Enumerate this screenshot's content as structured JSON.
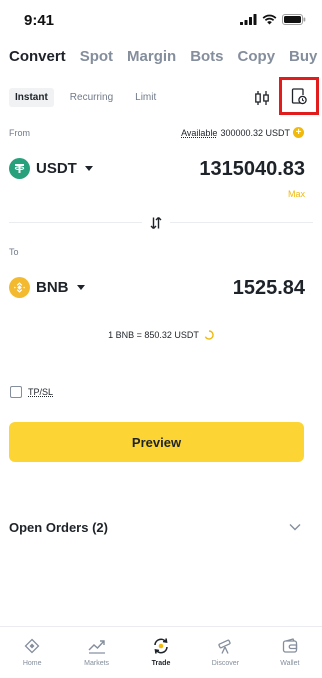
{
  "status_bar": {
    "time": "9:41"
  },
  "top_tabs": [
    {
      "label": "Convert",
      "active": true
    },
    {
      "label": "Spot",
      "active": false
    },
    {
      "label": "Margin",
      "active": false
    },
    {
      "label": "Bots",
      "active": false
    },
    {
      "label": "Copy",
      "active": false
    },
    {
      "label": "Buy",
      "active": false
    }
  ],
  "mode_tabs": [
    {
      "label": "Instant",
      "active": true
    },
    {
      "label": "Recurring",
      "active": false
    },
    {
      "label": "Limit",
      "active": false
    }
  ],
  "from": {
    "label": "From",
    "available_label": "Available",
    "available_value": "300000.32 USDT",
    "asset": "USDT",
    "amount": "1315040.83",
    "max_label": "Max"
  },
  "to": {
    "label": "To",
    "asset": "BNB",
    "amount": "1525.84"
  },
  "rate": {
    "text": "1 BNB = 850.32 USDT"
  },
  "tpsl": {
    "label": "TP/SL"
  },
  "preview": {
    "label": "Preview"
  },
  "open_orders": {
    "title": "Open Orders (2)"
  },
  "bottom_nav": [
    {
      "label": "Home",
      "icon": "home-icon",
      "active": false
    },
    {
      "label": "Markets",
      "icon": "markets-icon",
      "active": false
    },
    {
      "label": "Trade",
      "icon": "trade-icon",
      "active": true
    },
    {
      "label": "Discover",
      "icon": "discover-icon",
      "active": false
    },
    {
      "label": "Wallet",
      "icon": "wallet-icon",
      "active": false
    }
  ],
  "colors": {
    "accent": "#fcd535",
    "brand_yellow": "#f0b90b",
    "usdt": "#26a17b",
    "bnb": "#f3ba2f",
    "highlight_border": "#e11c1c"
  }
}
